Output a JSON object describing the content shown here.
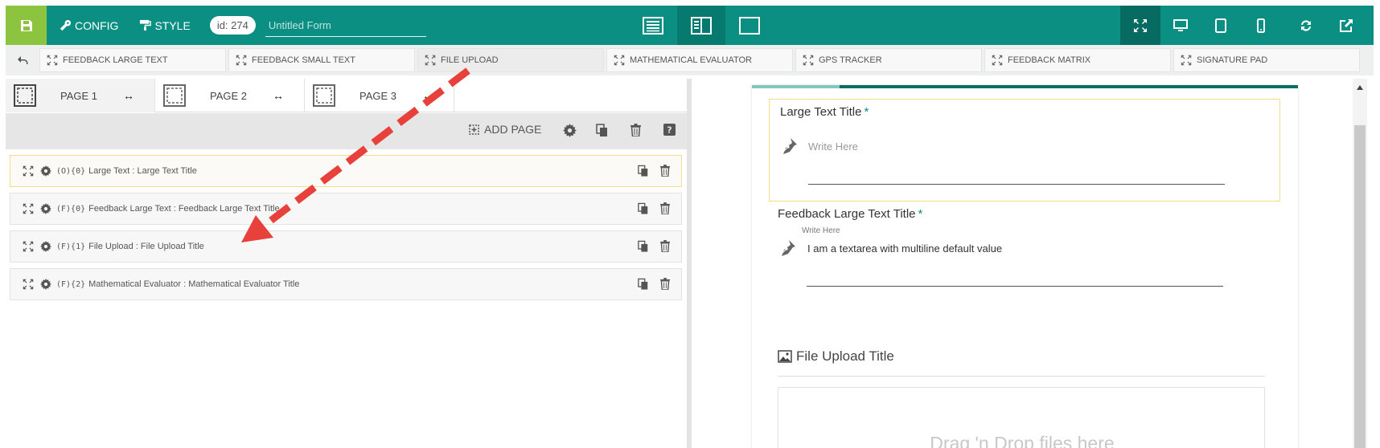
{
  "topbar": {
    "config_label": "CONFIG",
    "style_label": "STYLE",
    "id_label": "id: 274",
    "form_name": "Untitled Form"
  },
  "toolbox": {
    "items": [
      {
        "label": "FEEDBACK LARGE TEXT"
      },
      {
        "label": "FEEDBACK SMALL TEXT"
      },
      {
        "label": "FILE UPLOAD"
      },
      {
        "label": "MATHEMATICAL EVALUATOR"
      },
      {
        "label": "GPS TRACKER"
      },
      {
        "label": "FEEDBACK MATRIX"
      },
      {
        "label": "SIGNATURE PAD"
      }
    ]
  },
  "pages": {
    "tabs": [
      {
        "label": "PAGE 1"
      },
      {
        "label": "PAGE 2"
      },
      {
        "label": "PAGE 3"
      }
    ],
    "add_page_label": "ADD PAGE"
  },
  "fields": [
    {
      "code": "(O){0}",
      "label": "Large Text : Large Text Title"
    },
    {
      "code": "(F){0}",
      "label": "Feedback Large Text : Feedback Large Text Title"
    },
    {
      "code": "(F){1}",
      "label": "File Upload : File Upload Title"
    },
    {
      "code": "(F){2}",
      "label": "Mathematical Evaluator : Mathematical Evaluator Title"
    }
  ],
  "preview": {
    "progress": 0.16,
    "q1": {
      "title": "Large Text Title",
      "required": "*",
      "placeholder": "Write Here"
    },
    "q2": {
      "title": "Feedback Large Text Title",
      "required": "*",
      "label": "Write Here",
      "value": "I am a textarea with multiline default value"
    },
    "q3": {
      "title": "File Upload Title",
      "dropzone": "Drag 'n Drop files here"
    }
  },
  "colors": {
    "primary": "#0c8f83",
    "save": "#8cc43f",
    "highlight": "#f3dc8a",
    "arrow": "#e8403a"
  }
}
